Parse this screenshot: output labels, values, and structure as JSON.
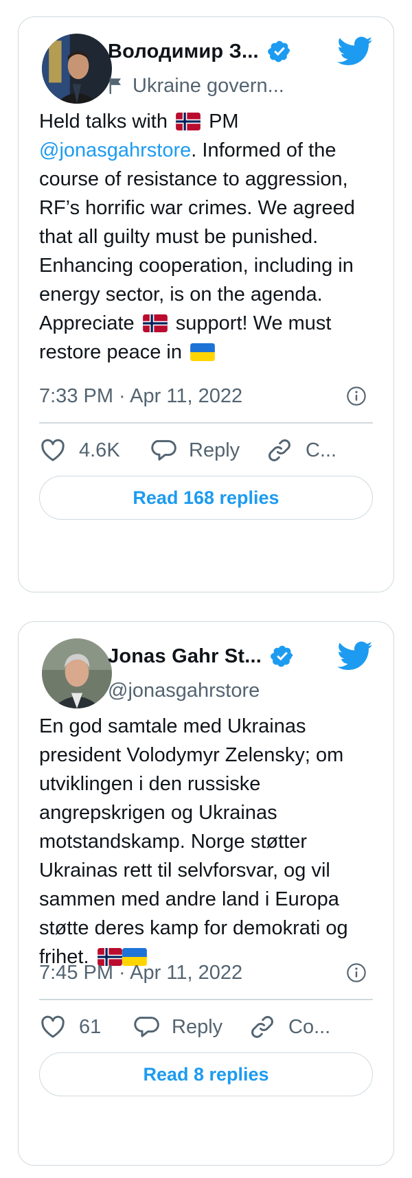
{
  "colors": {
    "accent": "#1d9bf0",
    "text": "#0f1419",
    "muted": "#536471",
    "border": "#cfd9de"
  },
  "tweets": [
    {
      "author_name": "Володимир З...",
      "author_subtitle": "Ukraine govern...",
      "subtitle_icon": "flag-icon",
      "text_part1": "Held talks with",
      "text_part2": " PM",
      "mention": "@jonasgahrstore",
      "text_part3": ". Informed of the course of resistance to aggression, RF’s horrific war crimes. We agreed that all guilty must be punished. Enhancing cooperation, including in energy sector, is on the agenda. Appreciate",
      "text_part4": " support! We must restore peace in",
      "timestamp": "7:33 PM · Apr 11, 2022",
      "likes": "4.6K",
      "reply_label": "Reply",
      "copy_label": "C...",
      "read_replies": "Read 168 replies"
    },
    {
      "author_name": "Jonas Gahr St...",
      "author_subtitle": "@jonasgahrstore",
      "text": "En god samtale med Ukrainas president Volodymyr Zelensky; om utviklingen i den russiske angrepskrigen og Ukrainas motstandskamp. Norge støtter Ukrainas rett til selvforsvar, og vil sammen med andre land i Europa støtte deres kamp for demokrati og frihet.",
      "timestamp": "7:45 PM · Apr 11, 2022",
      "likes": "61",
      "reply_label": "Reply",
      "copy_label": "Co...",
      "read_replies": "Read 8 replies"
    }
  ]
}
